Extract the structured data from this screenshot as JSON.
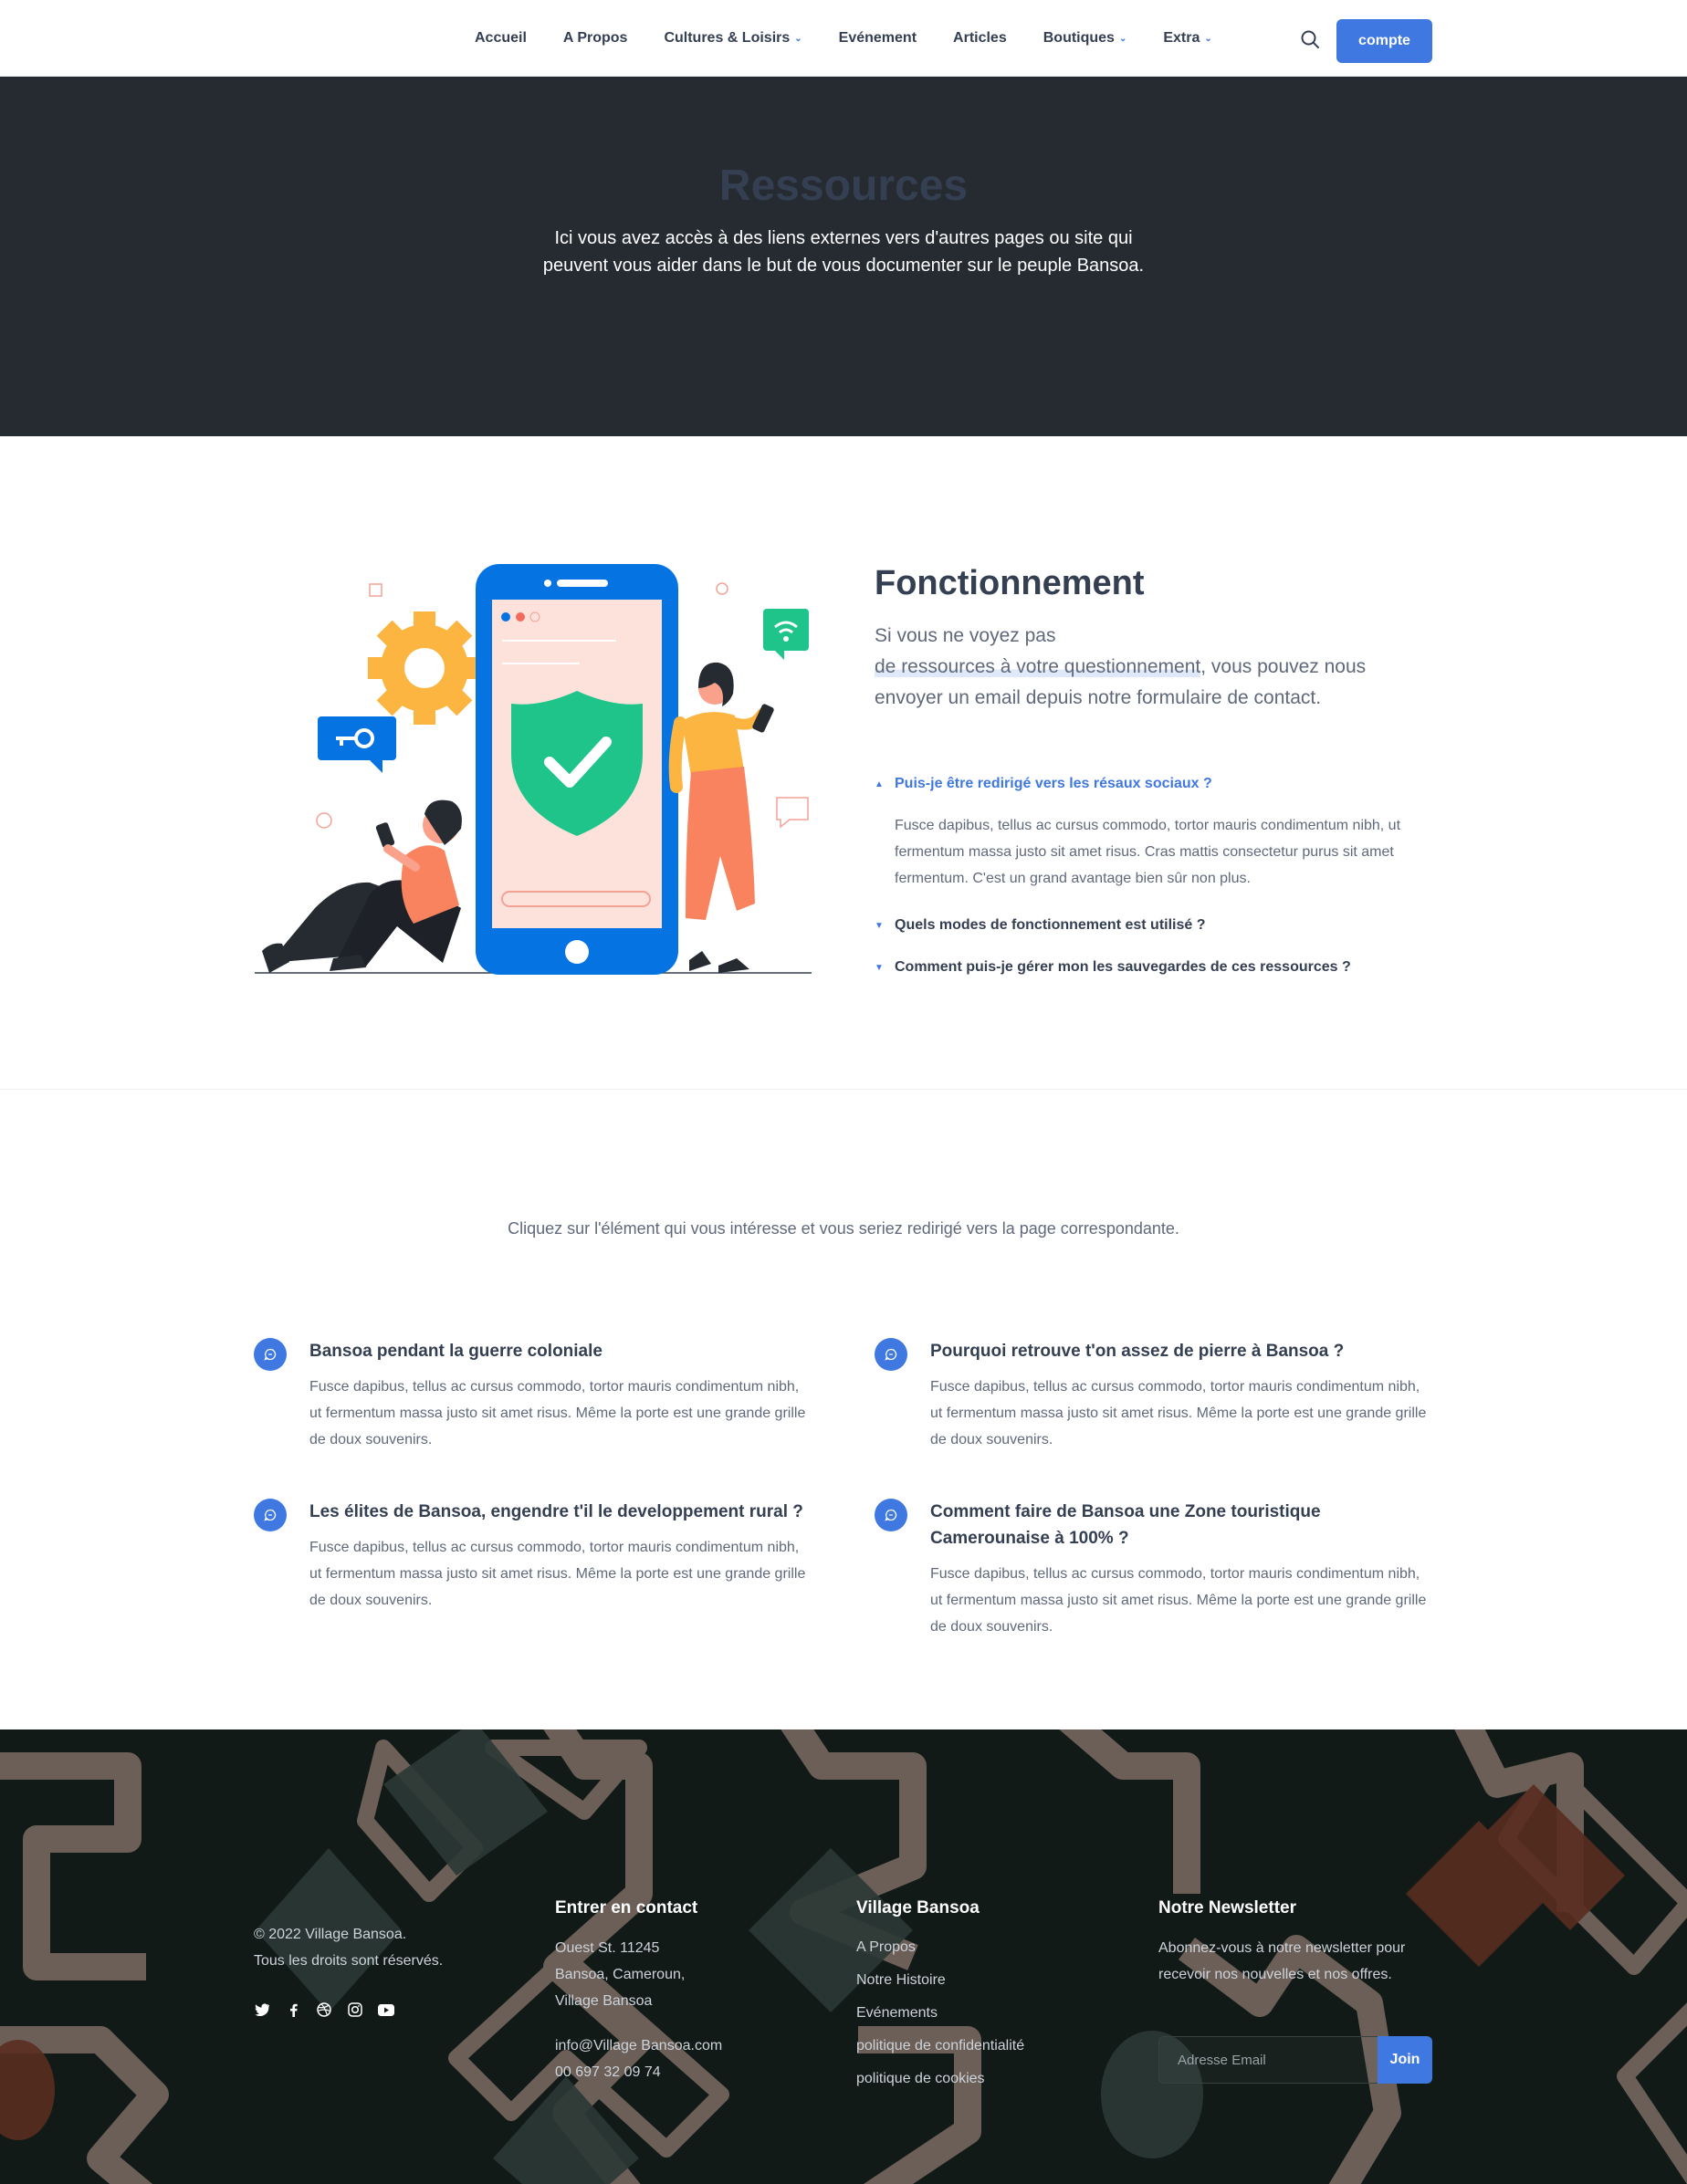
{
  "nav": {
    "items": [
      {
        "label": "Accueil",
        "dropdown": false
      },
      {
        "label": "A Propos",
        "dropdown": false
      },
      {
        "label": "Cultures & Loisirs",
        "dropdown": true
      },
      {
        "label": "Evénement",
        "dropdown": false
      },
      {
        "label": "Articles",
        "dropdown": false
      },
      {
        "label": "Boutiques",
        "dropdown": true
      },
      {
        "label": "Extra",
        "dropdown": true
      }
    ],
    "account_label": "compte",
    "search_icon": "search-icon"
  },
  "hero": {
    "title": "Ressources",
    "text": "Ici vous avez accès à des liens externes vers d'autres pages ou site qui peuvent vous aider dans le but de vous documenter sur le peuple Bansoa."
  },
  "fonctionnement": {
    "title": "Fonctionnement",
    "lead_1": "Si vous ne voyez pas",
    "lead_highlight": "de ressources à votre questionnement",
    "lead_2": ", vous pouvez nous envoyer un email depuis notre formulaire de contact.",
    "accordion": [
      {
        "question": "Puis-je être redirigé vers les résaux sociaux ?",
        "answer": "Fusce dapibus, tellus ac cursus commodo, tortor mauris condimentum nibh, ut fermentum massa justo sit amet risus. Cras mattis consectetur purus sit amet fermentum. C'est un grand avantage bien sûr non plus.",
        "open": true
      },
      {
        "question": "Quels modes de fonctionnement est utilisé ?",
        "open": false
      },
      {
        "question": "Comment puis-je gérer mon les sauvegardes de ces ressources ?",
        "open": false
      }
    ]
  },
  "resources": {
    "intro": "Cliquez sur l'élément qui vous intéresse et vous seriez redirigé vers la page correspondante.",
    "items": [
      {
        "title": "Bansoa pendant la guerre coloniale",
        "text": "Fusce dapibus, tellus ac cursus commodo, tortor mauris condimentum nibh, ut fermentum massa justo sit amet risus. Même la porte est une grande grille de doux souvenirs."
      },
      {
        "title": "Pourquoi retrouve t'on assez de pierre à Bansoa ?",
        "text": "Fusce dapibus, tellus ac cursus commodo, tortor mauris condimentum nibh, ut fermentum massa justo sit amet risus. Même la porte est une grande grille de doux souvenirs."
      },
      {
        "title": "Les élites de Bansoa, engendre t'il le developpement rural ?",
        "text": "Fusce dapibus, tellus ac cursus commodo, tortor mauris condimentum nibh, ut fermentum massa justo sit amet risus. Même la porte est une grande grille de doux souvenirs."
      },
      {
        "title": "Comment faire de Bansoa une Zone touristique Camerounaise à 100% ?",
        "text": "Fusce dapibus, tellus ac cursus commodo, tortor mauris condimentum nibh, ut fermentum massa justo sit amet risus. Même la porte est une grande grille de doux souvenirs."
      }
    ]
  },
  "footer": {
    "copyright_line1": "© 2022 Village Bansoa.",
    "copyright_line2": "Tous les droits sont réservés.",
    "social_icons": [
      "twitter-icon",
      "facebook-icon",
      "dribbble-icon",
      "instagram-icon",
      "youtube-icon"
    ],
    "contact": {
      "title": "Entrer en contact",
      "address_1": "Ouest St. 11245",
      "address_2": "Bansoa, Cameroun,",
      "address_3": "Village Bansoa",
      "email": "info@Village Bansoa.com",
      "phone": "00 697 32 09 74"
    },
    "village": {
      "title": "Village Bansoa",
      "links": [
        "A Propos",
        "Notre Histoire",
        "Evénements",
        "politique de confidentialité",
        "politique de cookies"
      ]
    },
    "newsletter": {
      "title": "Notre Newsletter",
      "text": "Abonnez-vous à notre newsletter pour recevoir nos nouvelles et nos offres.",
      "placeholder": "Adresse Email",
      "button": "Join"
    }
  },
  "colors": {
    "primary": "#3f78e0",
    "dark": "#262b32",
    "heading": "#343f52",
    "body": "#60697b",
    "footer_bg": "#121a18"
  }
}
